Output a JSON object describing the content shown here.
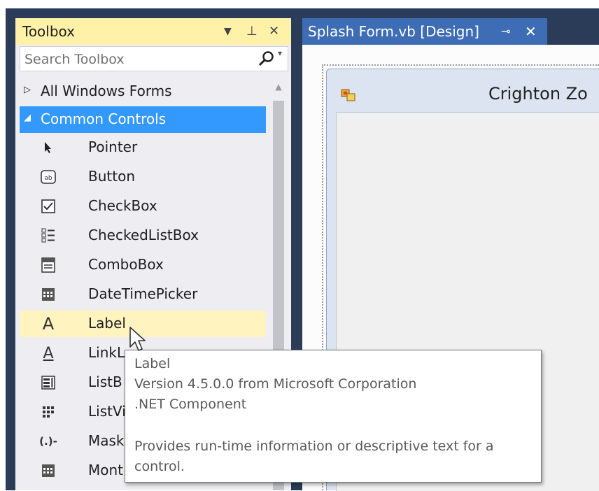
{
  "toolbox": {
    "title": "Toolbox",
    "search_placeholder": "Search Toolbox",
    "groups": [
      {
        "label": "All Windows Forms"
      },
      {
        "label": "Common Controls"
      }
    ],
    "items": [
      {
        "label": "Pointer",
        "icon": "pointer-icon"
      },
      {
        "label": "Button",
        "icon": "button-icon"
      },
      {
        "label": "CheckBox",
        "icon": "checkbox-icon"
      },
      {
        "label": "CheckedListBox",
        "icon": "checked-listbox-icon"
      },
      {
        "label": "ComboBox",
        "icon": "combobox-icon"
      },
      {
        "label": "DateTimePicker",
        "icon": "datetimepicker-icon"
      },
      {
        "label": "Label",
        "icon": "label-icon"
      },
      {
        "label": "LinkL",
        "icon": "linklabel-icon"
      },
      {
        "label": "ListB",
        "icon": "listbox-icon"
      },
      {
        "label": "ListVi",
        "icon": "listview-icon"
      },
      {
        "label": "Mask",
        "icon": "maskedtextbox-icon"
      },
      {
        "label": "Mont",
        "icon": "monthcalendar-icon"
      }
    ]
  },
  "document_tab": {
    "title": "Splash Form.vb [Design]",
    "pin_glyph": "⊸",
    "close_glyph": "✕"
  },
  "form": {
    "title": "Crighton Zo"
  },
  "tooltip": {
    "name": "Label",
    "version": "Version 4.5.0.0 from Microsoft Corporation",
    "component": ".NET Component",
    "description_line1": "Provides run-time information or descriptive text for a",
    "description_line2": "control."
  },
  "colors": {
    "toolbox_header": "#fff1a8",
    "selected_group": "#3399ff",
    "hover_item": "#fff3c0",
    "document_tab": "#3e6db5",
    "frame": "#2b3c59"
  }
}
